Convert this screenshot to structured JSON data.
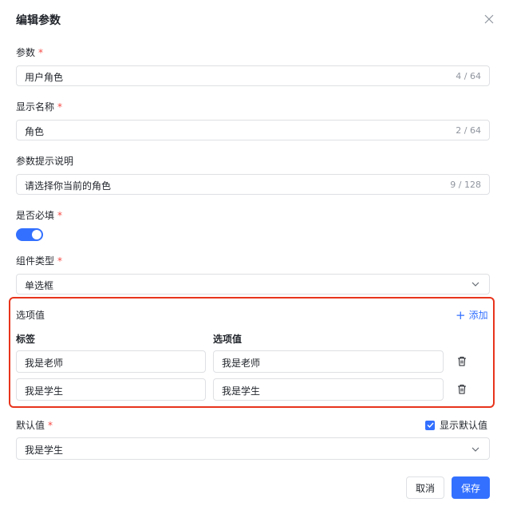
{
  "dialog": {
    "title": "编辑参数"
  },
  "param": {
    "label": "参数",
    "required_mark": "*",
    "value": "用户角色",
    "count": "4 / 64"
  },
  "display_name": {
    "label": "显示名称",
    "required_mark": "*",
    "value": "角色",
    "count": "2 / 64"
  },
  "hint": {
    "label": "参数提示说明",
    "value": "请选择你当前的角色",
    "count": "9 / 128"
  },
  "required": {
    "label": "是否必填",
    "required_mark": "*",
    "enabled": true
  },
  "component_type": {
    "label": "组件类型",
    "required_mark": "*",
    "selected": "单选框"
  },
  "options": {
    "title": "选项值",
    "add_label": "添加",
    "col_label": "标签",
    "col_value": "选项值",
    "rows": [
      {
        "label": "我是老师",
        "value": "我是老师"
      },
      {
        "label": "我是学生",
        "value": "我是学生"
      }
    ]
  },
  "default_value": {
    "label": "默认值",
    "required_mark": "*",
    "selected": "我是学生",
    "show_default_label": "显示默认值",
    "show_default_checked": true
  },
  "footer": {
    "cancel_label": "取消",
    "save_label": "保存"
  },
  "colors": {
    "accent": "#3370ff",
    "required": "#f54a45",
    "highlight_border": "#e8341c"
  },
  "icons": {
    "close": "close-icon",
    "chevron": "chevron-down-icon",
    "trash": "trash-icon",
    "plus": "plus-icon",
    "check": "check-icon"
  }
}
